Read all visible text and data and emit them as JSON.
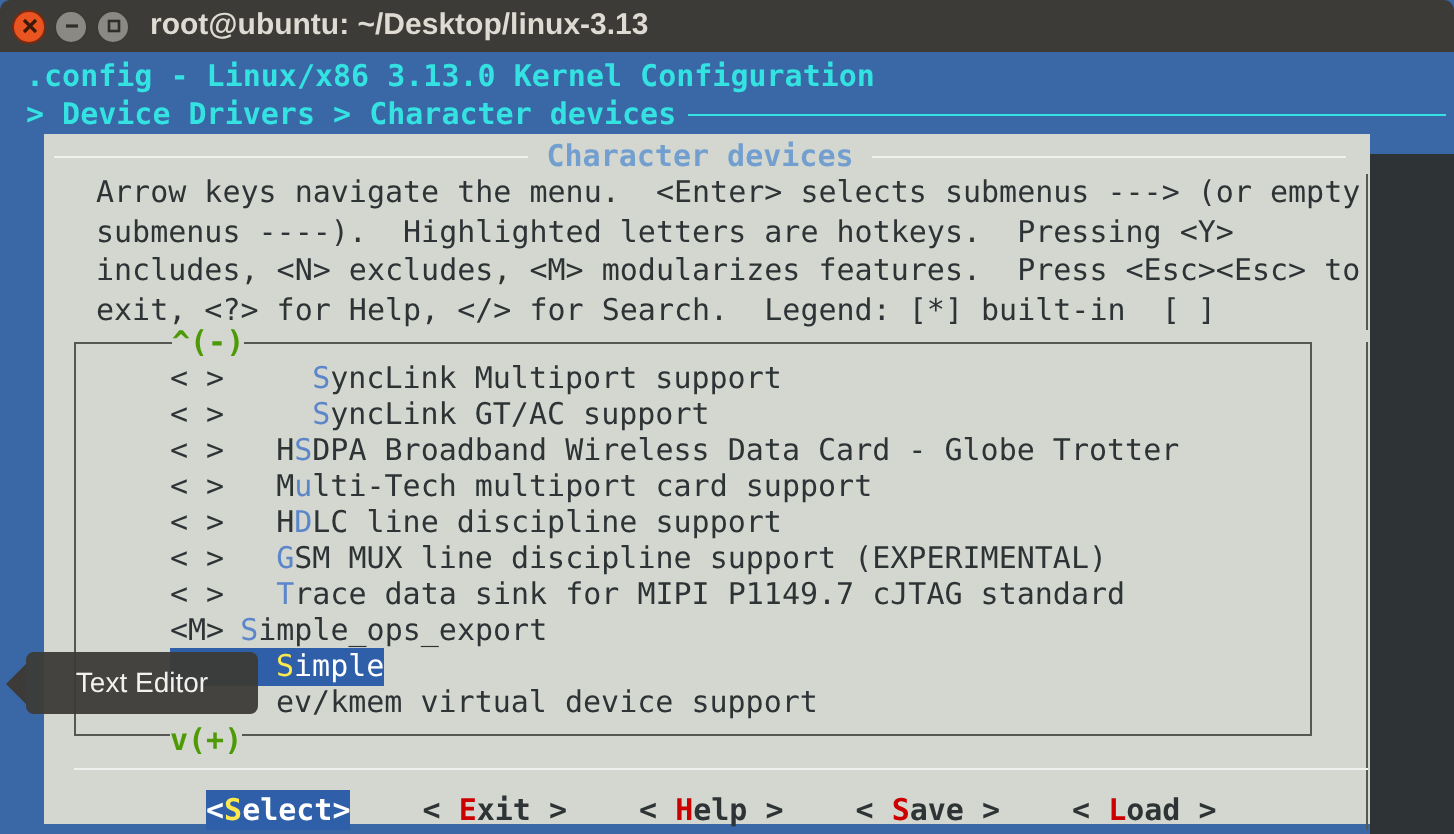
{
  "window": {
    "title": "root@ubuntu: ~/Desktop/linux-3.13"
  },
  "header": {
    "title": ".config - Linux/x86 3.13.0 Kernel Configuration",
    "breadcrumb": "> Device Drivers > Character devices"
  },
  "dialog": {
    "title": "Character devices",
    "help_lines": [
      "Arrow keys navigate the menu.  <Enter> selects submenus ---> (or empty",
      "submenus ----).  Highlighted letters are hotkeys.  Pressing <Y>",
      "includes, <N> excludes, <M> modularizes features.  Press <Esc><Esc> to",
      "exit, <?> for Help, </> for Search.  Legend: [*] built-in  [ ]"
    ],
    "scroll_up": "^(-)",
    "scroll_down": "v(+)",
    "items": [
      {
        "kind": "sub",
        "marker": "< >",
        "hotkey": "S",
        "rest": "yncLink Multiport support",
        "selected": false
      },
      {
        "kind": "sub",
        "marker": "< >",
        "hotkey": "S",
        "rest": "yncLink GT/AC support",
        "selected": false
      },
      {
        "kind": "item",
        "marker": "< >",
        "before": "H",
        "hotkey": "S",
        "rest": "DPA Broadband Wireless Data Card - Globe Trotter",
        "selected": false
      },
      {
        "kind": "item",
        "marker": "< >",
        "before": "M",
        "hotkey": "u",
        "rest": "lti-Tech multiport card support",
        "selected": false
      },
      {
        "kind": "item",
        "marker": "< >",
        "before": "H",
        "hotkey": "D",
        "rest": "LC line discipline support",
        "selected": false
      },
      {
        "kind": "item",
        "marker": "< >",
        "hotkey": "G",
        "rest": "SM MUX line discipline support (EXPERIMENTAL)",
        "selected": false
      },
      {
        "kind": "item",
        "marker": "< >",
        "hotkey": "T",
        "rest": "race data sink for MIPI P1149.7 cJTAG standard",
        "selected": false
      },
      {
        "kind": "module",
        "marker": "<M>",
        "hotkey": "S",
        "rest": "imple_ops_export",
        "selected": false
      },
      {
        "kind": "item",
        "hotkey": "S",
        "rest": "imple",
        "selected": true
      },
      {
        "kind": "covered",
        "rest": "ev/kmem virtual device support",
        "selected": false
      }
    ],
    "buttons": [
      {
        "open": "<",
        "hotkey": "S",
        "rest": "elect",
        "close": ">",
        "selected": true
      },
      {
        "open": "< ",
        "hotkey": "E",
        "rest": "xit",
        "close": " >",
        "selected": false
      },
      {
        "open": "< ",
        "hotkey": "H",
        "rest": "elp",
        "close": " >",
        "selected": false
      },
      {
        "open": "< ",
        "hotkey": "S",
        "rest": "ave",
        "close": " >",
        "selected": false
      },
      {
        "open": "< ",
        "hotkey": "L",
        "rest": "oad",
        "close": " >",
        "selected": false
      }
    ]
  },
  "tooltip": {
    "text": "Text Editor"
  }
}
